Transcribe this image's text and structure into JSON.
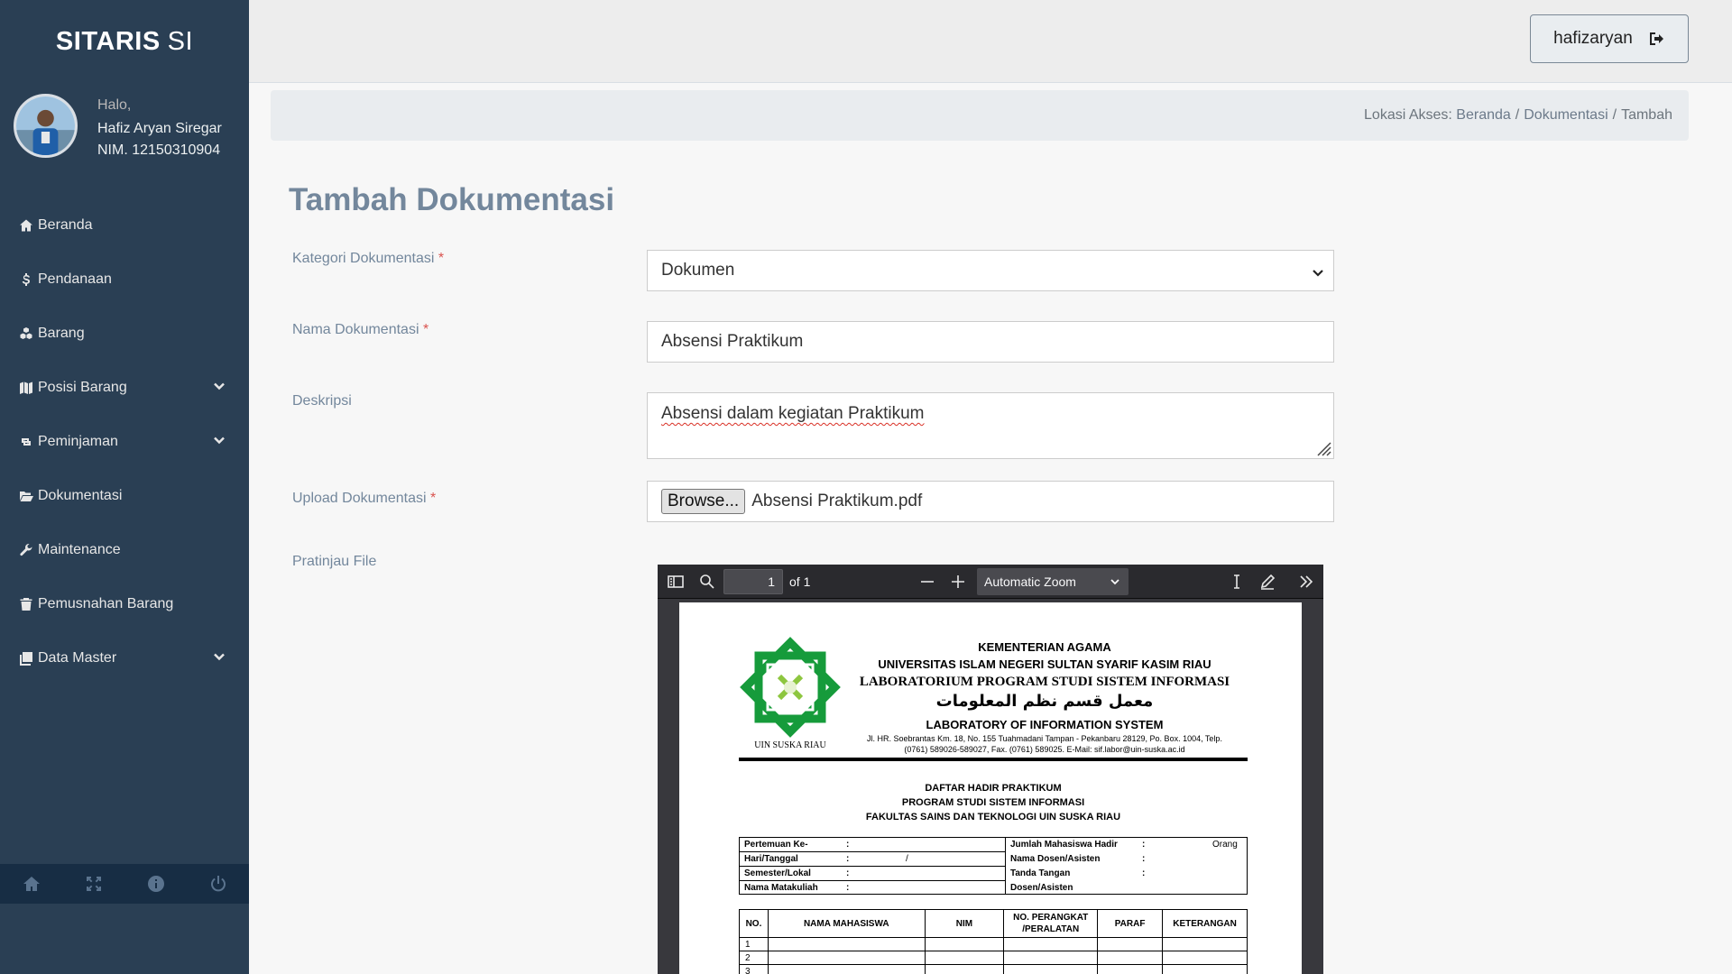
{
  "app": {
    "brand_bold": "SITARIS",
    "brand_light": "SI"
  },
  "profile": {
    "greeting": "Halo,",
    "name": "Hafiz Aryan Siregar",
    "nim": "NIM. 12150310904"
  },
  "sidebar": {
    "items": [
      {
        "label": "Beranda",
        "icon": "home-icon",
        "has_submenu": false
      },
      {
        "label": "Pendanaan",
        "icon": "dollar-icon",
        "has_submenu": false
      },
      {
        "label": "Barang",
        "icon": "cubes-icon",
        "has_submenu": false
      },
      {
        "label": "Posisi Barang",
        "icon": "map-icon",
        "has_submenu": true
      },
      {
        "label": "Peminjaman",
        "icon": "retweet-icon",
        "has_submenu": true
      },
      {
        "label": "Dokumentasi",
        "icon": "folder-open-icon",
        "has_submenu": false
      },
      {
        "label": "Maintenance",
        "icon": "wrench-icon",
        "has_submenu": false
      },
      {
        "label": "Pemusnahan Barang",
        "icon": "trash-icon",
        "has_submenu": false
      },
      {
        "label": "Data Master",
        "icon": "clone-icon",
        "has_submenu": true
      }
    ],
    "footer_icons": [
      "home-icon",
      "fullscreen-icon",
      "info-icon",
      "power-icon"
    ]
  },
  "topnav": {
    "username": "hafizaryan",
    "logout_icon": "sign-out-icon"
  },
  "breadcrumb": {
    "prefix": "Lokasi Akses:",
    "items": [
      "Beranda",
      "Dokumentasi",
      "Tambah"
    ],
    "separator": "/"
  },
  "form": {
    "title": "Tambah Dokumentasi",
    "required_mark": "*",
    "kategori": {
      "label": "Kategori Dokumentasi",
      "value": "Dokumen"
    },
    "nama": {
      "label": "Nama Dokumentasi",
      "value": "Absensi Praktikum"
    },
    "deskripsi": {
      "label": "Deskripsi",
      "value": "Absensi dalam kegiatan Praktikum"
    },
    "upload": {
      "label": "Upload Dokumentasi",
      "button": "Browse...",
      "filename": "Absensi Praktikum.pdf"
    },
    "preview": {
      "label": "Pratinjau File"
    }
  },
  "pdf_viewer": {
    "page_number": "1",
    "page_total": "of 1",
    "zoom": "Automatic Zoom"
  },
  "pdf_document": {
    "logo_text": "UIN SUSKA RIAU",
    "header": [
      "KEMENTERIAN AGAMA",
      "UNIVERSITAS ISLAM NEGERI SULTAN SYARIF KASIM RIAU",
      "LABORATORIUM PROGRAM STUDI SISTEM INFORMASI",
      "معمل قسم نظم المعلومات",
      "LABORATORY OF INFORMATION SYSTEM",
      "Jl. HR. Soebrantas Km. 18, No. 155 Tuahmadani Tampan - Pekanbaru 28129, Po. Box. 1004, Telp.",
      "(0761) 589026-589027, Fax. (0761) 589025. E-Mail: sif.labor@uin-suska.ac.id"
    ],
    "titles": [
      "DAFTAR HADIR PRAKTIKUM",
      "PROGRAM STUDI SISTEM INFORMASI",
      "FAKULTAS SAINS DAN TEKNOLOGI UIN SUSKA RIAU"
    ],
    "info_left": [
      {
        "label": "Pertemuan Ke-",
        "sep": ":",
        "value": ""
      },
      {
        "label": "Hari/Tanggal",
        "sep": ":",
        "value": "/"
      },
      {
        "label": "Semester/Lokal",
        "sep": ":",
        "value": ""
      },
      {
        "label": "Nama Matakuliah",
        "sep": ":",
        "value": ""
      }
    ],
    "info_right": [
      {
        "label": "Jumlah Mahasiswa Hadir",
        "sep": ":",
        "value": "Orang"
      },
      {
        "label": "Nama Dosen/Asisten",
        "sep": ":",
        "value": ""
      },
      {
        "label": "Tanda Tangan",
        "sep": ":",
        "value": ""
      },
      {
        "label": "Dosen/Asisten",
        "sep": "",
        "value": ""
      }
    ],
    "table_headers": [
      "NO.",
      "NAMA MAHASISWA",
      "NIM",
      "NO. PERANGKAT /PERALATAN",
      "PARAF",
      "KETERANGAN"
    ],
    "row_numbers": [
      "1",
      "2",
      "3"
    ]
  }
}
